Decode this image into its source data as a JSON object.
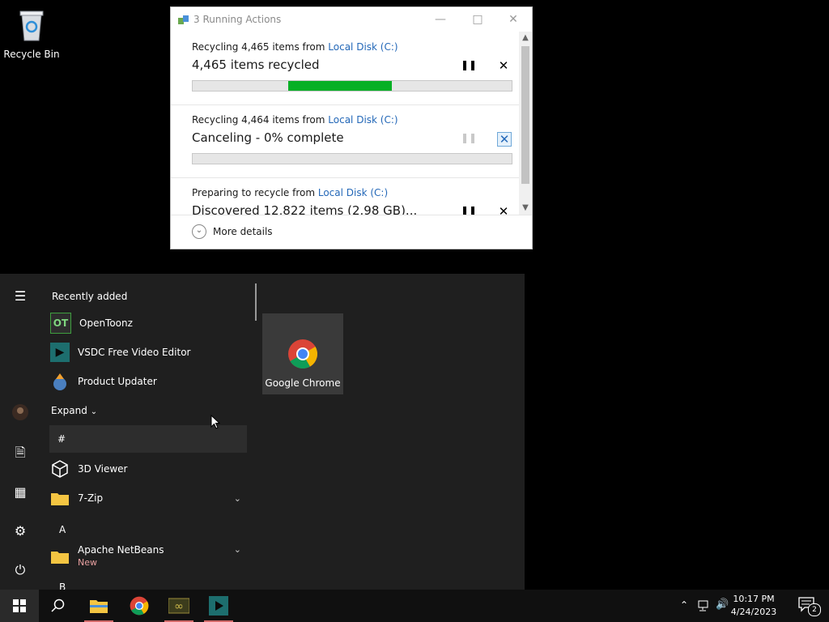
{
  "desktop": {
    "recycle_bin_label": "Recycle Bin"
  },
  "dialog": {
    "title": "3 Running Actions",
    "operations": [
      {
        "line1_prefix": "Recycling 4,465 items from ",
        "line1_link": "Local Disk (C:)",
        "status": "4,465 items recycled",
        "progress": 0.32
      },
      {
        "line1_prefix": "Recycling 4,464 items from ",
        "line1_link": "Local Disk (C:)",
        "status": "Canceling - 0% complete",
        "progress": 0
      },
      {
        "line1_prefix": "Preparing to recycle from ",
        "line1_link": "Local Disk (C:)",
        "status": "Discovered 12,822 items (2.98 GB)..."
      }
    ],
    "more_details": "More details"
  },
  "start_menu": {
    "recently_added": "Recently added",
    "recent_apps": [
      "OpenToonz",
      "VSDC Free Video Editor",
      "Product Updater"
    ],
    "expand": "Expand",
    "hash_header": "#",
    "apps": [
      {
        "label": "3D Viewer"
      },
      {
        "label": "7-Zip"
      }
    ],
    "section_a": "A",
    "netbeans": {
      "label": "Apache NetBeans",
      "badge": "New"
    },
    "section_b": "B",
    "tile": {
      "label": "Google Chrome"
    }
  },
  "taskbar": {
    "time": "10:17 PM",
    "date": "4/24/2023",
    "notifications_count": "2"
  },
  "colors": {
    "progress_green": "#06b025",
    "link_blue": "#2468b8",
    "start_bg": "#1f1f1f"
  }
}
